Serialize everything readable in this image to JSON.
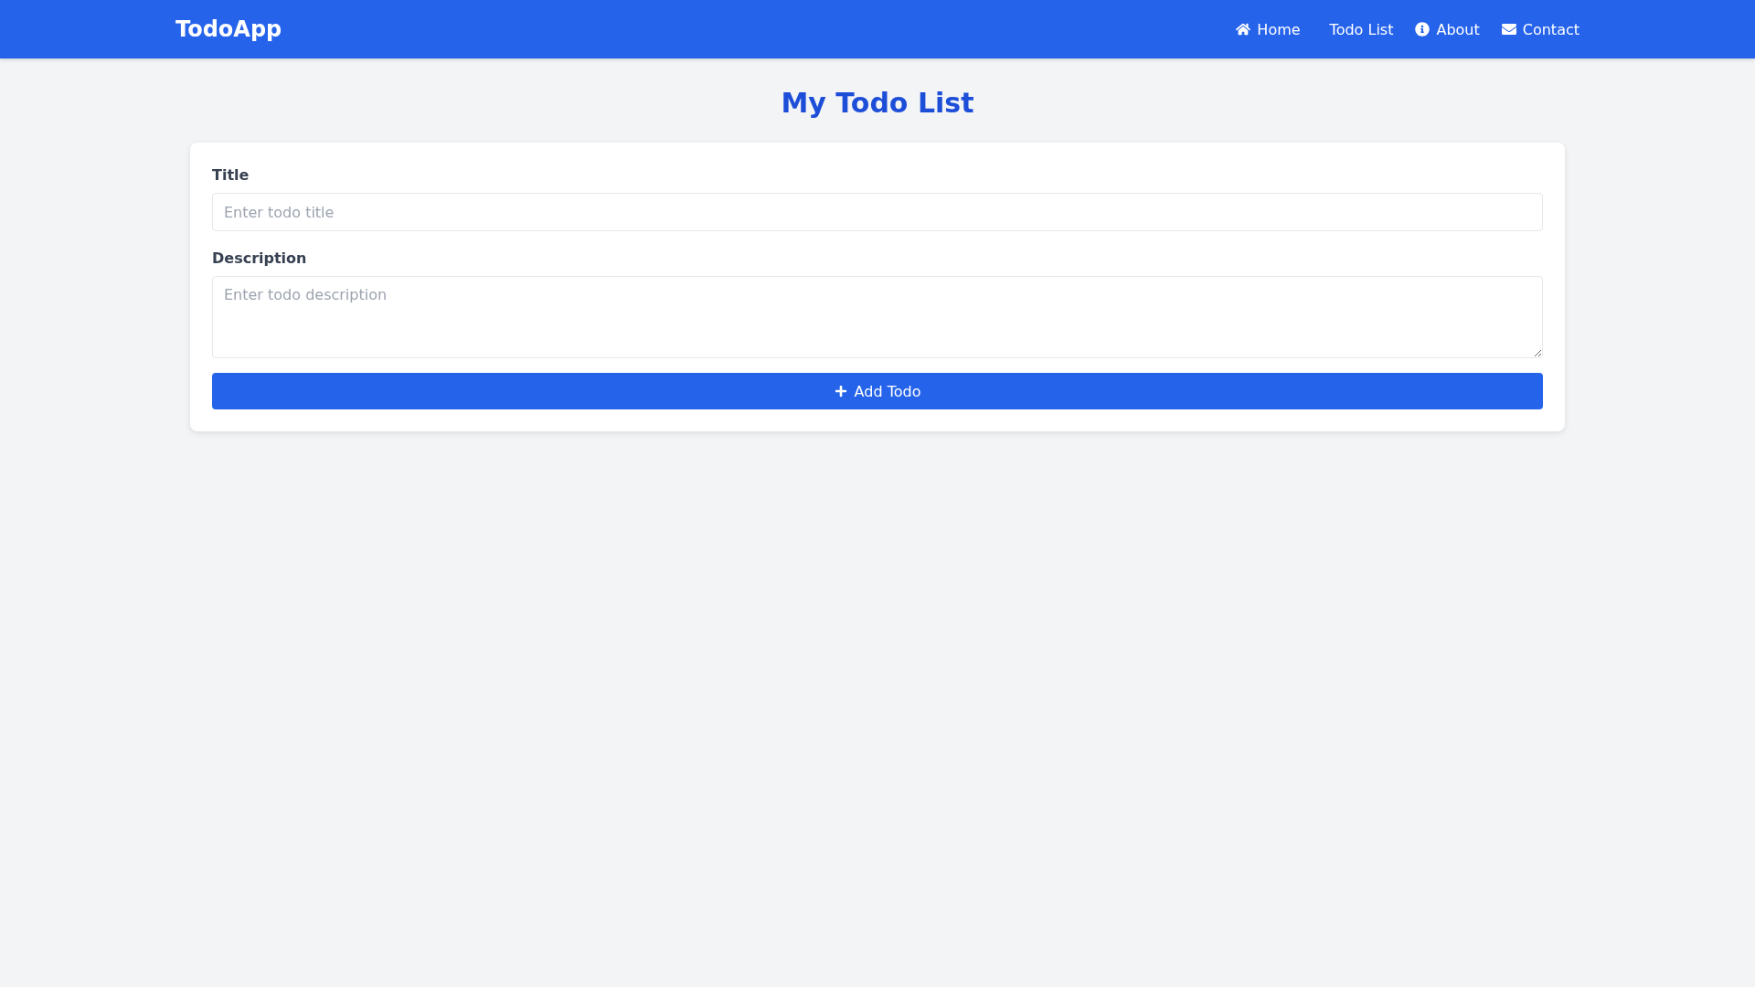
{
  "navbar": {
    "brand": "TodoApp",
    "links": [
      {
        "label": "Home"
      },
      {
        "label": "Todo List"
      },
      {
        "label": "About"
      },
      {
        "label": "Contact"
      }
    ]
  },
  "heading": "My Todo List",
  "form": {
    "fields": [
      {
        "kind": "input",
        "label": "Title",
        "placeholder": "Enter todo title"
      },
      {
        "kind": "textarea",
        "label": "Description",
        "placeholder": "Enter todo description"
      }
    ],
    "submit": {
      "label": "Add Todo"
    }
  }
}
